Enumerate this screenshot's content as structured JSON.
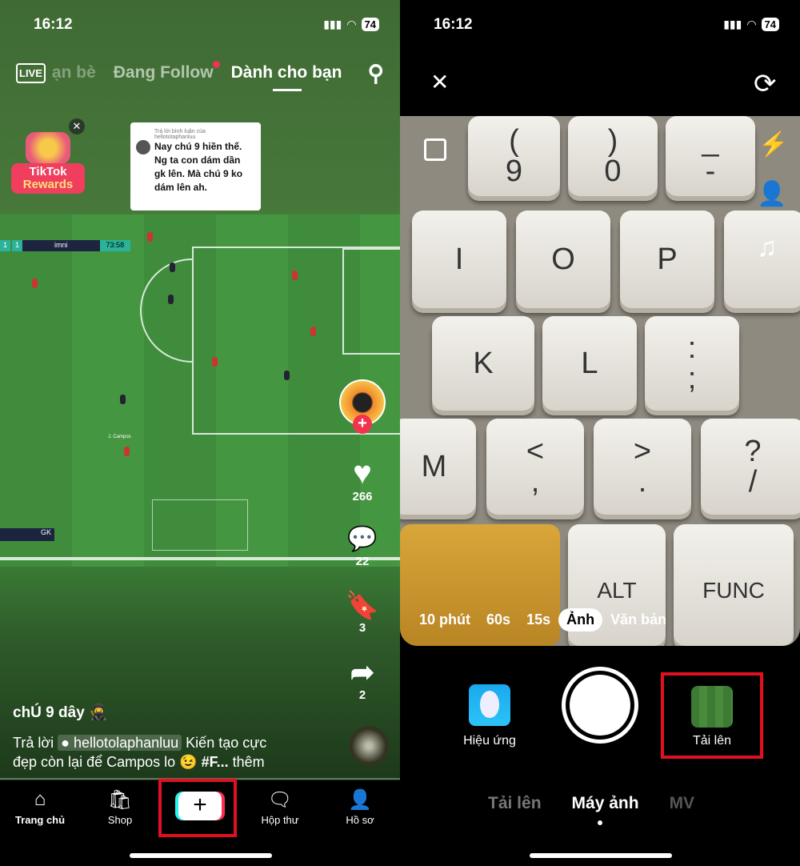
{
  "left": {
    "status": {
      "time": "16:12",
      "battery": "74"
    },
    "top_nav": {
      "live": "LIVE",
      "tabs": [
        "ạn bè",
        "Đang Follow",
        "Dành cho bạn"
      ],
      "active_tab": "Dành cho bạn"
    },
    "rewards": {
      "line1": "TikTok",
      "line2": "Rewards"
    },
    "reply_bubble": {
      "header": "Trả lời bình luận của",
      "user": "hellototaphanluu",
      "text": "Nay chú 9 hiền thế. Ng ta con dám dần gk lên. Mà chú 9 ko dám lên ah."
    },
    "scoreboard": {
      "home": "1",
      "away": "1",
      "team": "imni",
      "clock": "73:58"
    },
    "overlay": {
      "gk": "GK",
      "player_label": "J. Campos"
    },
    "actions": {
      "likes": "266",
      "comments": "22",
      "saves": "3",
      "shares": "2"
    },
    "caption": {
      "author": "chÚ 9 dây 🥷",
      "reply_prefix": "Trả lời",
      "mention": "hellotolaphanluu",
      "text1": "Kiến tạo cực",
      "text2": "đẹp còn lại để Campos lo 😉",
      "hashtag": "#F...",
      "more": "thêm"
    },
    "bottom_nav": [
      {
        "label": "Trang chủ",
        "icon": "home-icon"
      },
      {
        "label": "Shop",
        "icon": "shop-icon"
      },
      {
        "label": "",
        "icon": "plus-icon"
      },
      {
        "label": "Hộp thư",
        "icon": "inbox-icon"
      },
      {
        "label": "Hồ sơ",
        "icon": "profile-icon"
      }
    ],
    "highlight_color": "#e01020"
  },
  "right": {
    "status": {
      "time": "16:12",
      "battery": "74"
    },
    "keys": {
      "r1": [
        "(\n9",
        ")\n0",
        "_\n-"
      ],
      "r2": [
        "I",
        "O",
        "P"
      ],
      "r3": [
        "K",
        "L",
        ":\n;"
      ],
      "r4": [
        "M",
        "<\n,",
        ">\n.",
        "?\n/"
      ],
      "r5": [
        "",
        "ALT",
        "FUNC"
      ]
    },
    "modes": [
      "10 phút",
      "60s",
      "15s",
      "Ảnh",
      "Văn bản"
    ],
    "active_mode": "Ảnh",
    "effects_label": "Hiệu ứng",
    "upload_label": "Tải lên",
    "bottom_tabs": [
      "Tải lên",
      "Máy ảnh",
      "MV"
    ],
    "active_bottom_tab": "Máy ảnh"
  }
}
